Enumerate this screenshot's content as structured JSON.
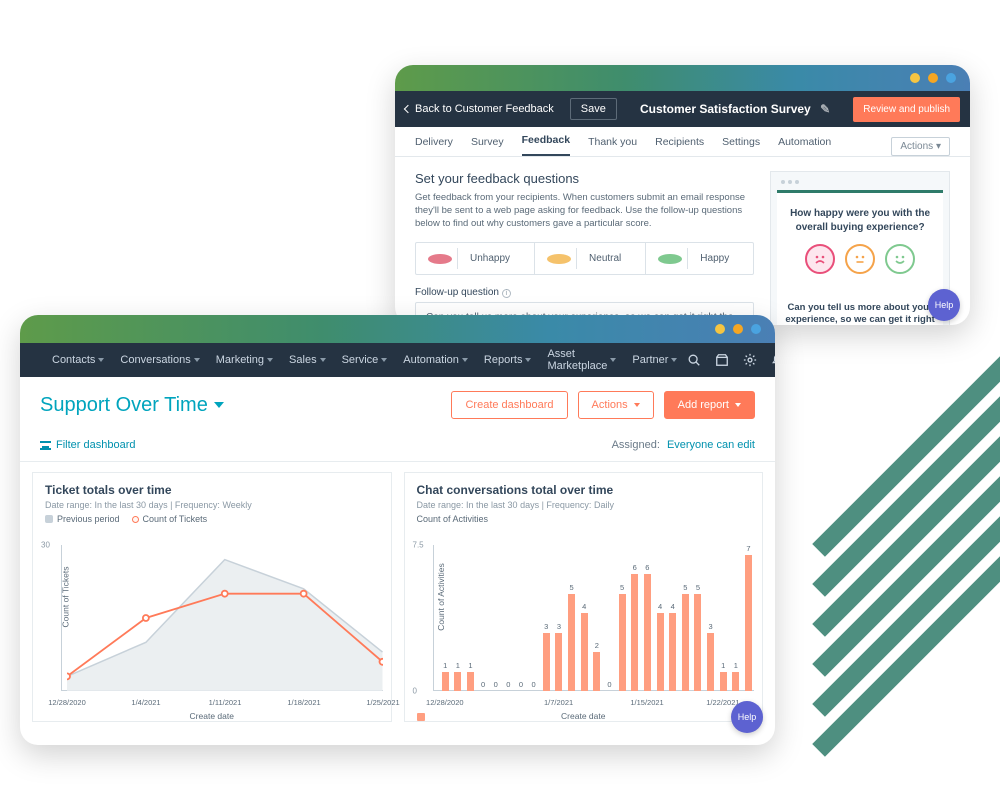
{
  "survey": {
    "back_label": "Back to Customer Feedback",
    "save": "Save",
    "title": "Customer Satisfaction Survey",
    "review": "Review and publish",
    "tabs": [
      "Delivery",
      "Survey",
      "Feedback",
      "Thank you",
      "Recipients",
      "Settings",
      "Automation"
    ],
    "actions_label": "Actions",
    "heading": "Set your feedback questions",
    "description": "Get feedback from your recipients. When customers submit an email response they'll be sent to a web page asking for feedback. Use the follow-up questions below to find out why customers gave a particular score.",
    "sentiments": {
      "unhappy": "Unhappy",
      "neutral": "Neutral",
      "happy": "Happy"
    },
    "fq_label": "Follow-up question",
    "fq_value": "Can you tell us more about your experience, so we can get it right the next time?",
    "preview_q": "How happy were you with the overall buying experience?",
    "preview_followup": "Can you tell us more about your experience, so we can get it right the next time?",
    "help": "Help"
  },
  "dash": {
    "nav": {
      "items": [
        "Contacts",
        "Conversations",
        "Marketing",
        "Sales",
        "Service",
        "Automation",
        "Reports",
        "Asset Marketplace",
        "Partner"
      ]
    },
    "title": "Support Over Time",
    "create": "Create dashboard",
    "actions": "Actions",
    "add": "Add report",
    "filter": "Filter dashboard",
    "assigned_label": "Assigned:",
    "assigned_value": "Everyone can edit",
    "help": "Help"
  },
  "chart_data": [
    {
      "type": "line",
      "title": "Ticket totals over time",
      "meta": "Date range: In the last 30 days  |  Frequency: Weekly",
      "ylabel": "Count of Tickets",
      "xlabel": "Create date",
      "categories": [
        "12/28/2020",
        "1/4/2021",
        "1/11/2021",
        "1/18/2021",
        "1/25/2021"
      ],
      "series": [
        {
          "name": "Previous period",
          "values": [
            3,
            10,
            27,
            21,
            8
          ],
          "style": "area-grey"
        },
        {
          "name": "Count of Tickets",
          "values": [
            3,
            15,
            20,
            20,
            6
          ],
          "style": "line-orange"
        }
      ],
      "ylim": [
        0,
        30
      ],
      "yticks": [
        30
      ]
    },
    {
      "type": "bar",
      "title": "Chat conversations total over time",
      "meta": "Date range: In the last 30 days  |  Frequency: Daily",
      "ylabel": "Count of Activities",
      "xlabel": "Create date",
      "legend": "Count of Activities",
      "categories": [
        "12/28/2020",
        "",
        "",
        "",
        "",
        "",
        "",
        "1/7/2021",
        "",
        "",
        "",
        "",
        "",
        "",
        "1/15/2021",
        "",
        "",
        "",
        "",
        "",
        "",
        "1/22/2021",
        "",
        "",
        ""
      ],
      "values": [
        1,
        1,
        1,
        0,
        0,
        0,
        0,
        0,
        3,
        3,
        5,
        4,
        2,
        0,
        5,
        6,
        6,
        4,
        4,
        5,
        5,
        3,
        1,
        1,
        7
      ],
      "ylim": [
        0,
        7.5
      ],
      "yticks": [
        0,
        7.5
      ],
      "xticks": [
        "12/28/2020",
        "1/7/2021",
        "1/15/2021",
        "1/22/2021"
      ]
    }
  ]
}
